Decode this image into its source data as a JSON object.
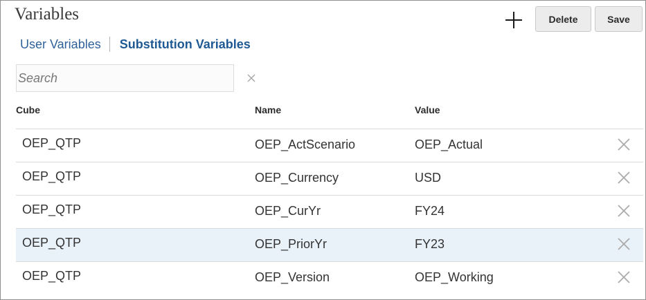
{
  "header": {
    "title": "Variables",
    "add_icon": "plus-icon",
    "delete_label": "Delete",
    "save_label": "Save"
  },
  "tabs": [
    {
      "label": "User Variables",
      "active": false
    },
    {
      "label": "Substitution Variables",
      "active": true
    }
  ],
  "search": {
    "placeholder": "Search",
    "value": "",
    "clear_icon": "close-icon"
  },
  "table": {
    "columns": [
      "Cube",
      "Name",
      "Value"
    ],
    "rows": [
      {
        "cube": "OEP_QTP",
        "name": "OEP_ActScenario",
        "value": "OEP_Actual"
      },
      {
        "cube": "OEP_QTP",
        "name": "OEP_Currency",
        "value": "USD"
      },
      {
        "cube": "OEP_QTP",
        "name": "OEP_CurYr",
        "value": "FY24"
      },
      {
        "cube": "OEP_QTP",
        "name": "OEP_PriorYr",
        "value": "FY23",
        "selected": true
      },
      {
        "cube": "OEP_QTP",
        "name": "OEP_Version",
        "value": "OEP_Working"
      }
    ],
    "row_delete_icon": "close-icon"
  },
  "colors": {
    "link": "#30629a",
    "active_tab": "#1f5a94",
    "selected_row": "#e9f1f9",
    "button_bg": "#ececec"
  }
}
